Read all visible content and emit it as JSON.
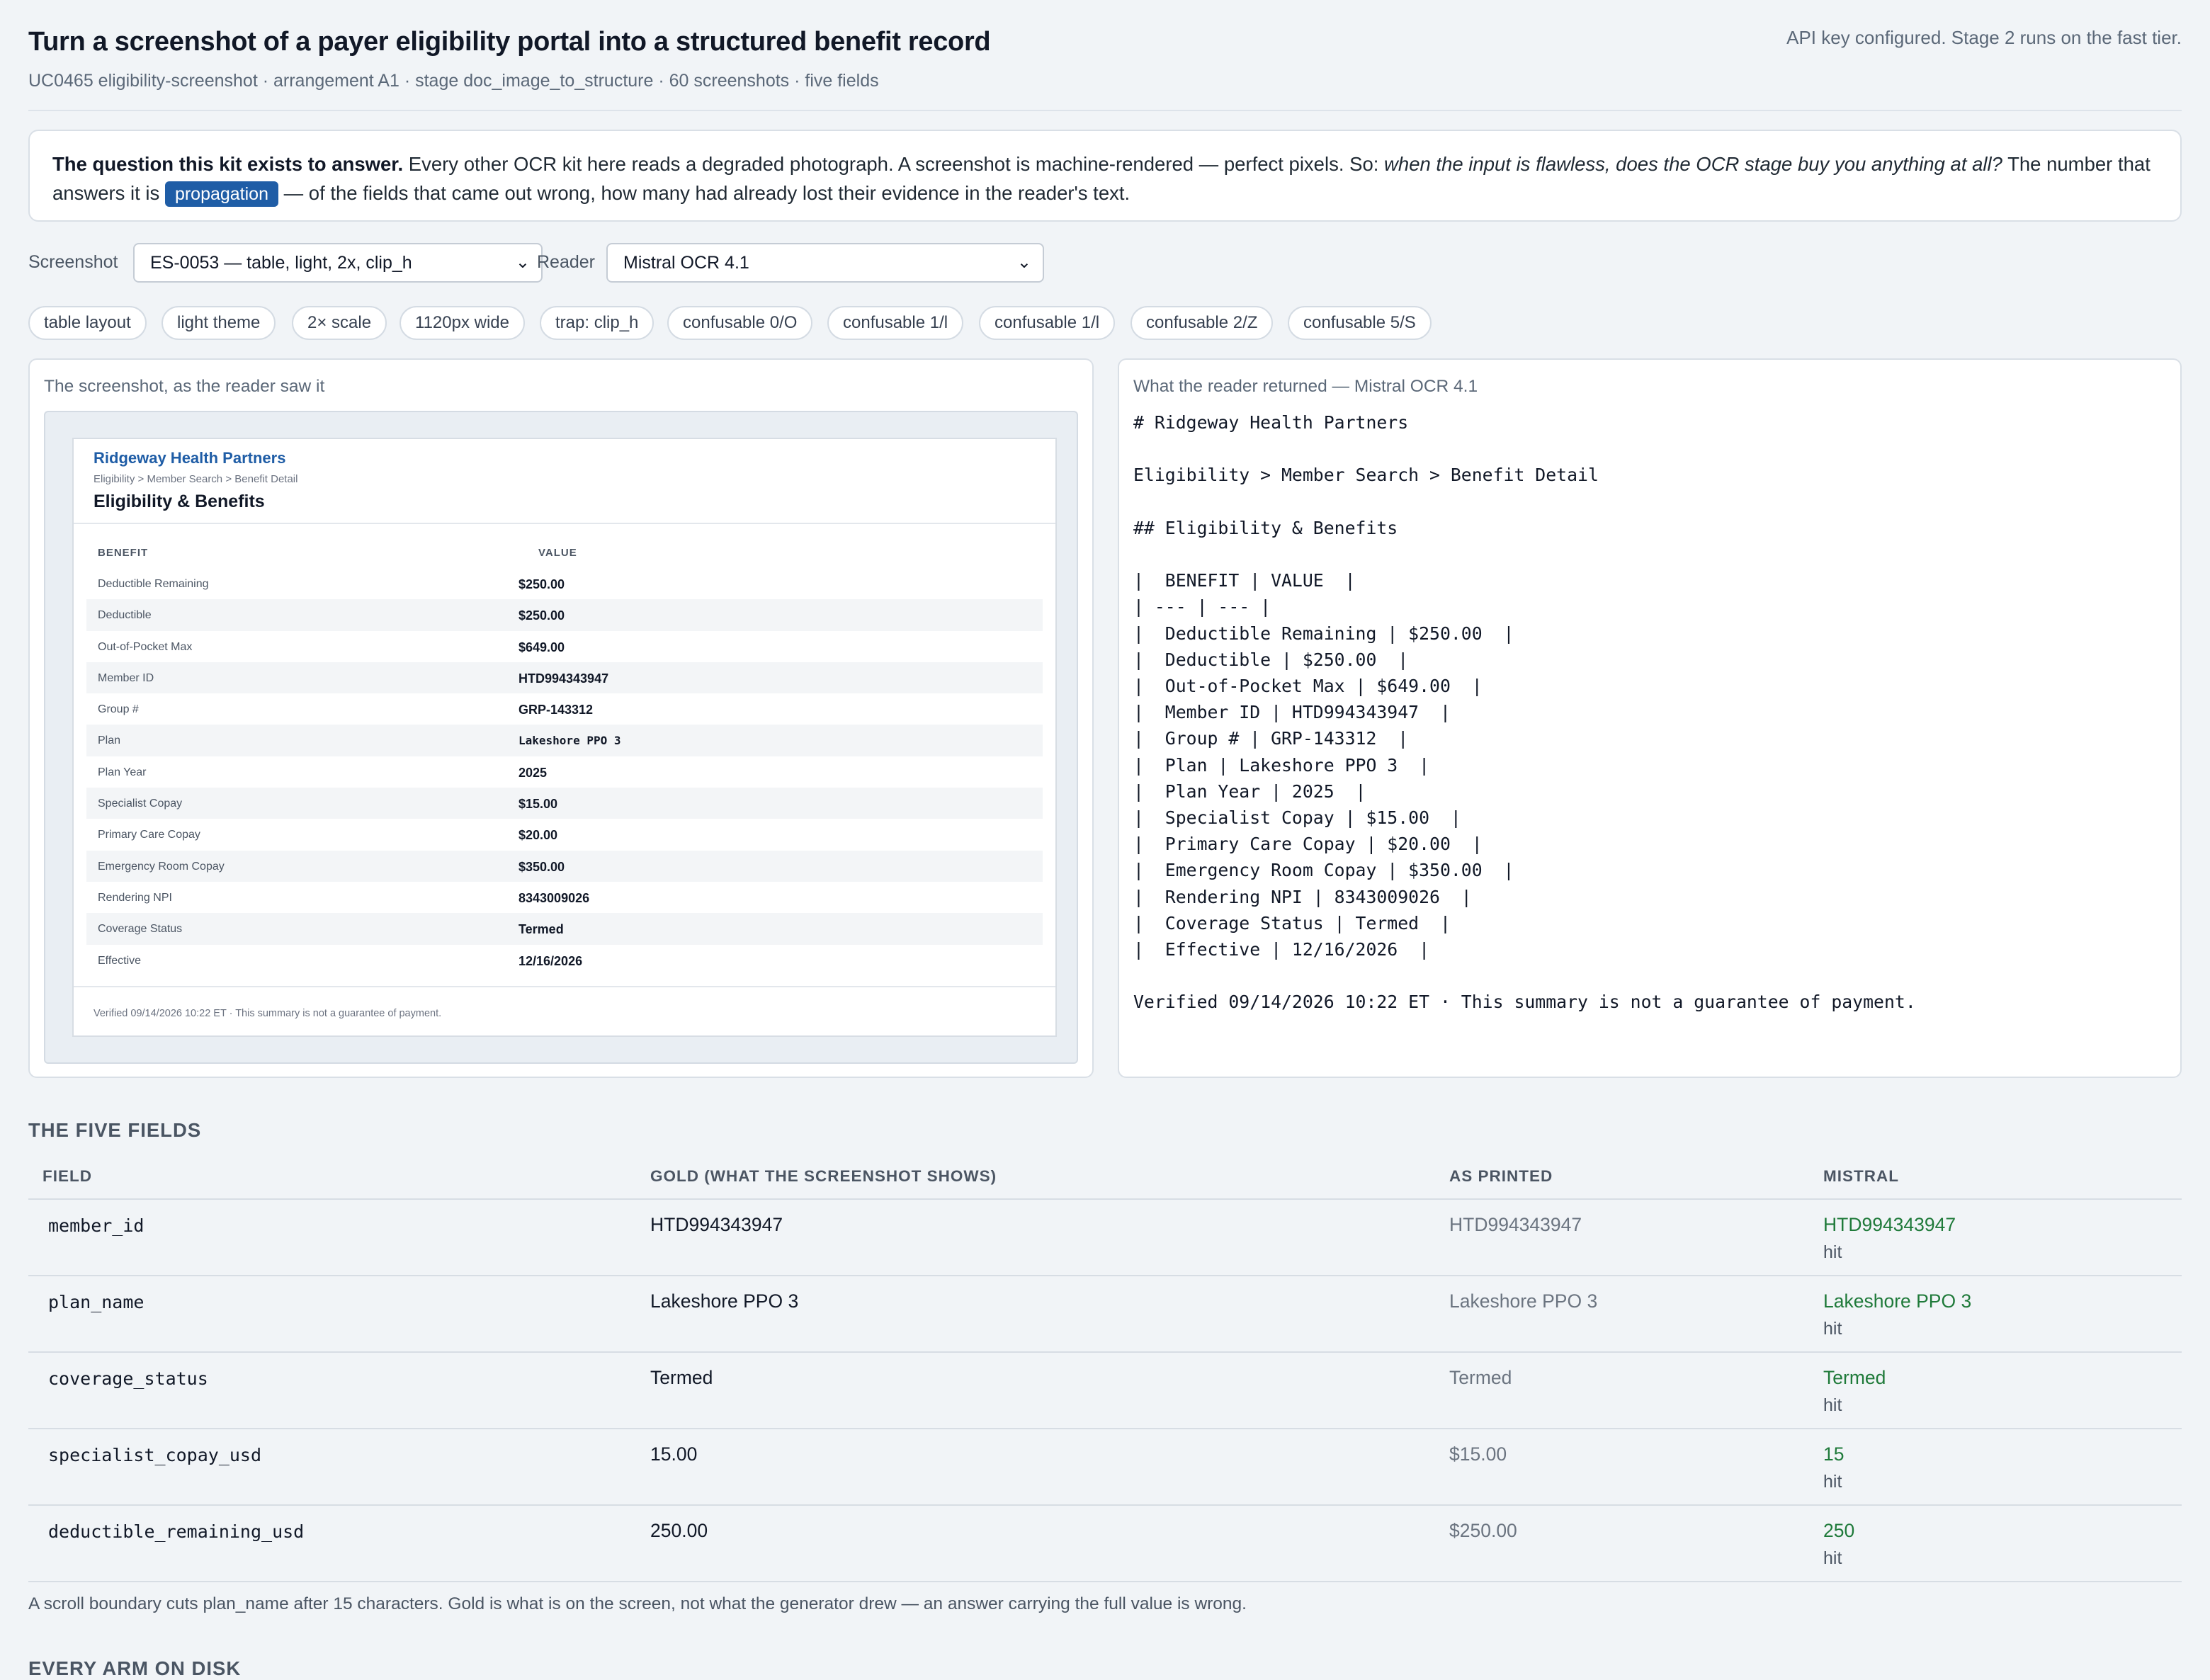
{
  "header": {
    "title": "Turn a screenshot of a payer eligibility portal into a structured benefit record",
    "subtitle": "UC0465 eligibility-screenshot · arrangement A1 · stage doc_image_to_structure · 60 screenshots · five fields",
    "api_note": "API key configured. Stage 2 runs on the fast tier."
  },
  "question": {
    "lead": "The question this kit exists to answer.",
    "text1": " Every other OCR kit here reads a degraded photograph. A screenshot is machine-rendered — perfect pixels. So: ",
    "emph": "when the input is flawless, does the OCR stage buy you anything at all?",
    "text2": " The number that answers it is ",
    "pill": "propagation",
    "text3": " — of the fields that came out wrong, how many had already lost their evidence in the reader's text."
  },
  "controls": {
    "screenshot_label": "Screenshot",
    "screenshot_value": "ES-0053 — table, light, 2x, clip_h",
    "reader_label": "Reader",
    "reader_value": "Mistral OCR 4.1"
  },
  "chips": [
    "table layout",
    "light theme",
    "2× scale",
    "1120px wide",
    "trap: clip_h",
    "confusable 0/O",
    "confusable 1/l",
    "confusable 1/l",
    "confusable 2/Z",
    "confusable 5/S"
  ],
  "left_panel": {
    "caption": "The screenshot, as the reader saw it",
    "shot": {
      "org": "Ridgeway Health Partners",
      "crumb": "Eligibility > Member Search > Benefit Detail",
      "heading": "Eligibility & Benefits",
      "col_benefit": "BENEFIT",
      "col_value": "VALUE",
      "rows": [
        {
          "k": "Deductible Remaining",
          "v": "$250.00"
        },
        {
          "k": "Deductible",
          "v": "$250.00"
        },
        {
          "k": "Out-of-Pocket Max",
          "v": "$649.00"
        },
        {
          "k": "Member ID",
          "v": "HTD994343947"
        },
        {
          "k": "Group #",
          "v": "GRP-143312"
        },
        {
          "k": "Plan",
          "v": "Lakeshore PPO 3"
        },
        {
          "k": "Plan Year",
          "v": "2025"
        },
        {
          "k": "Specialist Copay",
          "v": "$15.00"
        },
        {
          "k": "Primary Care Copay",
          "v": "$20.00"
        },
        {
          "k": "Emergency Room Copay",
          "v": "$350.00"
        },
        {
          "k": "Rendering NPI",
          "v": "8343009026"
        },
        {
          "k": "Coverage Status",
          "v": "Termed"
        },
        {
          "k": "Effective",
          "v": "12/16/2026"
        }
      ],
      "footer": "Verified 09/14/2026 10:22 ET · This summary is not a guarantee of payment."
    }
  },
  "right_panel": {
    "caption": "What the reader returned — Mistral OCR 4.1",
    "ocr_text": "# Ridgeway Health Partners\n\nEligibility > Member Search > Benefit Detail\n\n## Eligibility & Benefits\n\n|  BENEFIT | VALUE  |\n| --- | --- |\n|  Deductible Remaining | $250.00  |\n|  Deductible | $250.00  |\n|  Out-of-Pocket Max | $649.00  |\n|  Member ID | HTD994343947  |\n|  Group # | GRP-143312  |\n|  Plan | Lakeshore PPO 3  |\n|  Plan Year | 2025  |\n|  Specialist Copay | $15.00  |\n|  Primary Care Copay | $20.00  |\n|  Emergency Room Copay | $350.00  |\n|  Rendering NPI | 8343009026  |\n|  Coverage Status | Termed  |\n|  Effective | 12/16/2026  |\n\nVerified 09/14/2026 10:22 ET · This summary is not a guarantee of payment."
  },
  "fields": {
    "heading": "THE FIVE FIELDS",
    "columns": {
      "field": "FIELD",
      "gold": "GOLD (WHAT THE SCREENSHOT SHOWS)",
      "printed": "AS PRINTED",
      "reader": "MISTRAL"
    },
    "rows": [
      {
        "field": "member_id",
        "gold": "HTD994343947",
        "printed": "HTD994343947",
        "reader": "HTD994343947",
        "verdict": "hit"
      },
      {
        "field": "plan_name",
        "gold": "Lakeshore PPO 3",
        "printed": "Lakeshore PPO 3",
        "reader": "Lakeshore PPO 3",
        "verdict": "hit"
      },
      {
        "field": "coverage_status",
        "gold": "Termed",
        "printed": "Termed",
        "reader": "Termed",
        "verdict": "hit"
      },
      {
        "field": "specialist_copay_usd",
        "gold": "15.00",
        "printed": "$15.00",
        "reader": "15",
        "verdict": "hit"
      },
      {
        "field": "deductible_remaining_usd",
        "gold": "250.00",
        "printed": "$250.00",
        "reader": "250",
        "verdict": "hit"
      }
    ],
    "note": "A scroll boundary cuts plan_name after 15 characters. Gold is what is on the screen, not what the generator drew — an answer carrying the full value is wrong."
  },
  "arms": {
    "heading": "EVERY ARM ON DISK"
  },
  "colors": {
    "accent": "#1f5da6",
    "hit": "#1f7a3a",
    "background": "#f1f4f7"
  }
}
